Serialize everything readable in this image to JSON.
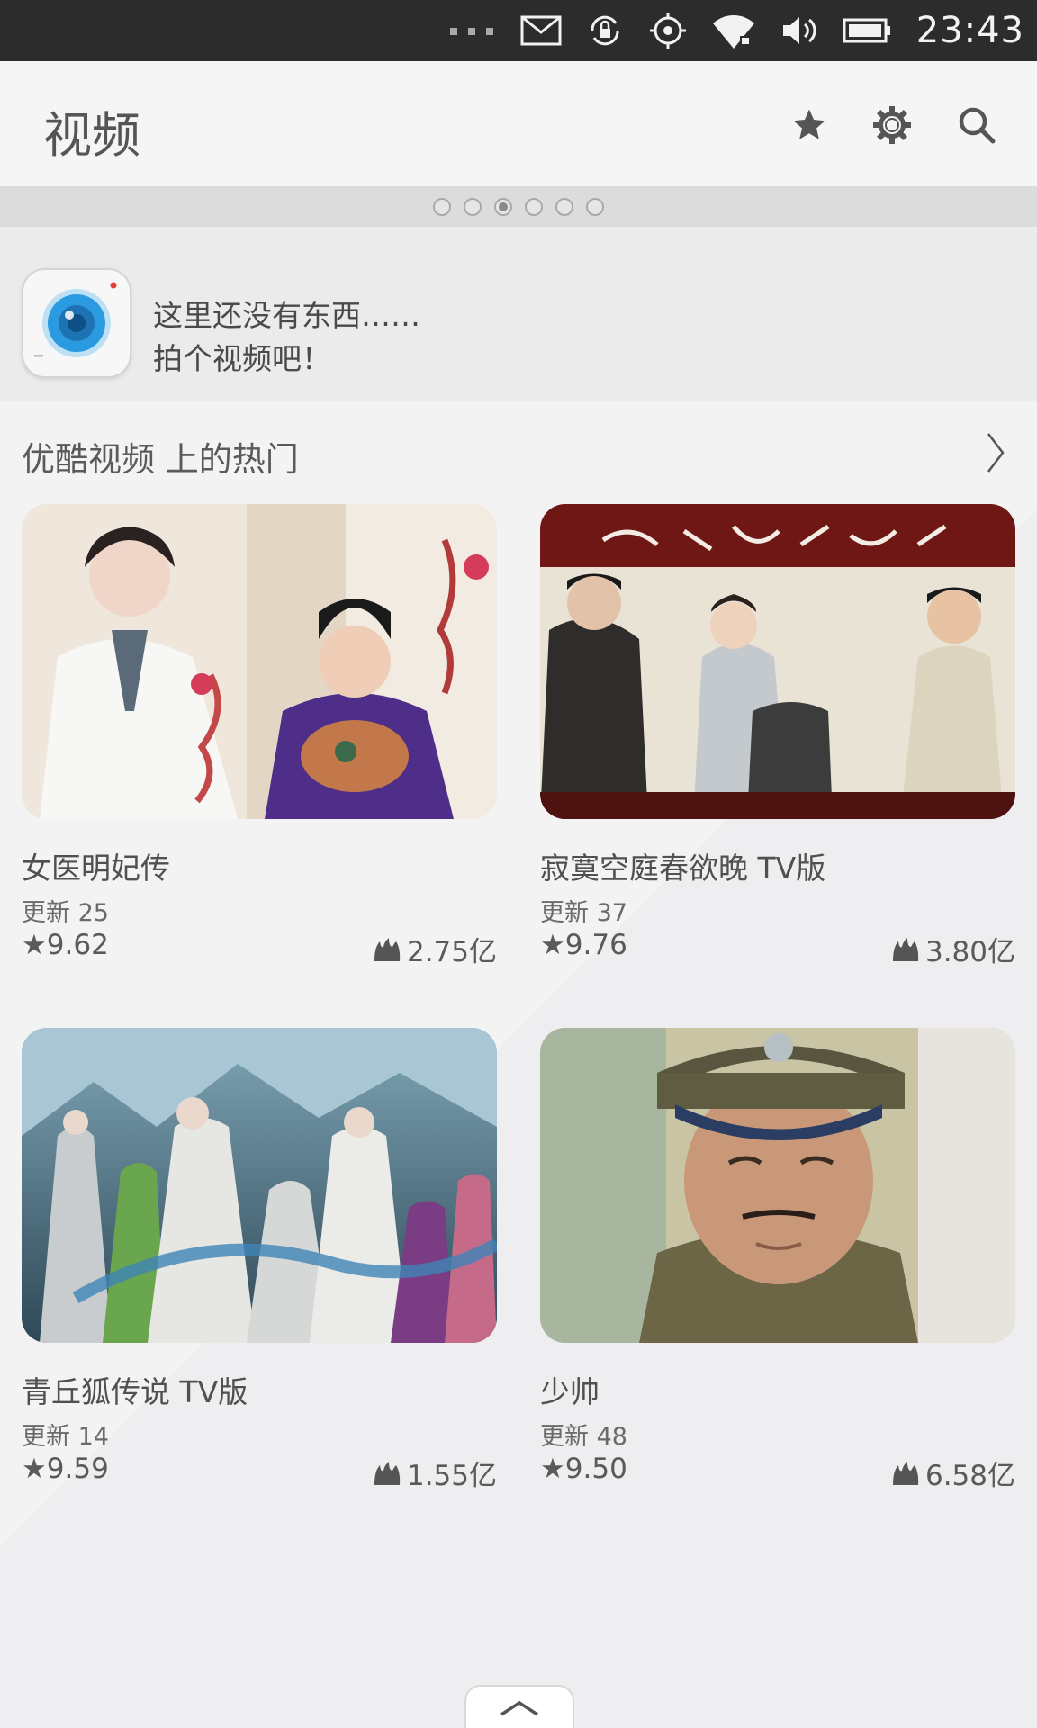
{
  "status_bar": {
    "time": "23:43",
    "icons": [
      "more-dots-icon",
      "mail-icon",
      "rotation-lock-icon",
      "location-icon",
      "wifi-icon",
      "volume-icon",
      "battery-icon"
    ]
  },
  "header": {
    "title": "视频",
    "actions": [
      "star-icon",
      "gear-icon",
      "search-icon"
    ]
  },
  "pager": {
    "count": 6,
    "active_index": 2
  },
  "empty_state": {
    "line1": "这里还没有东西……",
    "line2": "拍个视频吧！"
  },
  "section": {
    "title": "优酷视频 上的热门"
  },
  "videos": [
    {
      "title": "女医明妃传",
      "update": "更新 25",
      "rating": "★9.62",
      "views": "2.75亿"
    },
    {
      "title": "寂寞空庭春欲晚 TV版",
      "update": "更新 37",
      "rating": "★9.76",
      "views": "3.80亿"
    },
    {
      "title": "青丘狐传说 TV版",
      "update": "更新 14",
      "rating": "★9.59",
      "views": "1.55亿"
    },
    {
      "title": "少帅",
      "update": "更新 48",
      "rating": "★9.50",
      "views": "6.58亿"
    }
  ],
  "colors": {
    "status_bar_bg": "#2c2c2c",
    "header_bg": "#f5f5f5",
    "page_bg": "#f1f0f2",
    "camera_blue": "#2a9be0"
  }
}
